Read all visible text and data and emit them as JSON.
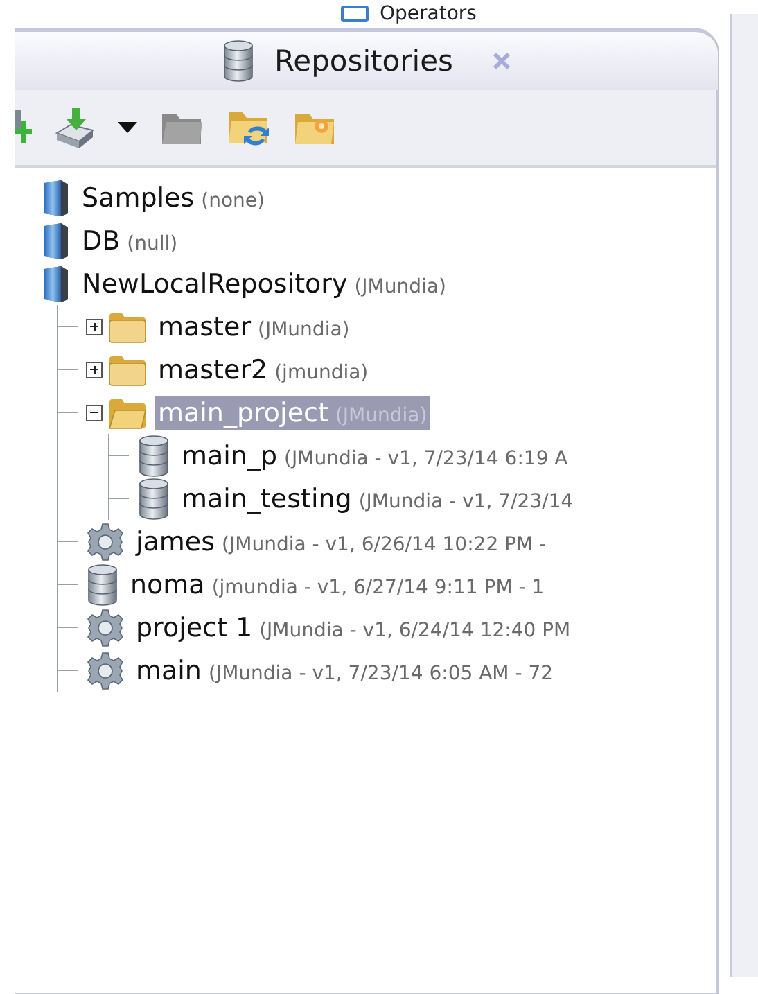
{
  "back_tab": {
    "label": "Operators"
  },
  "tab": {
    "label": "Repositories"
  },
  "toolbar": [
    {
      "kind": "add",
      "disabled": false
    },
    {
      "kind": "import",
      "disabled": false
    },
    {
      "kind": "caret",
      "disabled": false
    },
    {
      "kind": "folder",
      "disabled": true
    },
    {
      "kind": "refresh",
      "disabled": false
    },
    {
      "kind": "new-folder",
      "disabled": false
    }
  ],
  "tree": [
    {
      "kind": "repository",
      "name": "Samples",
      "detail": "(none)",
      "selected": false
    },
    {
      "kind": "repository",
      "name": "DB",
      "detail": "(null)",
      "selected": false
    },
    {
      "kind": "repository",
      "name": "NewLocalRepository",
      "detail": "(JMundia)",
      "selected": false,
      "children": [
        {
          "kind": "folder",
          "name": "master",
          "detail": "(JMundia)",
          "selected": false,
          "expanded": false
        },
        {
          "kind": "folder",
          "name": "master2",
          "detail": "(jmundia)",
          "selected": false,
          "expanded": false
        },
        {
          "kind": "folder",
          "name": "main_project",
          "detail": "(JMundia)",
          "selected": true,
          "expanded": true,
          "children": [
            {
              "kind": "data",
              "name": "main_p",
              "detail": "(JMundia - v1, 7/23/14 6:19 A",
              "selected": false
            },
            {
              "kind": "data",
              "name": "main_testing",
              "detail": "(JMundia - v1, 7/23/14",
              "selected": false
            }
          ]
        },
        {
          "kind": "process",
          "name": "james",
          "detail": "(JMundia - v1, 6/26/14 10:22 PM -",
          "selected": false
        },
        {
          "kind": "data",
          "name": "noma",
          "detail": "(jmundia - v1, 6/27/14 9:11 PM - 1",
          "selected": false
        },
        {
          "kind": "process",
          "name": "project 1",
          "detail": "(JMundia - v1, 6/24/14 12:40 PM",
          "selected": false
        },
        {
          "kind": "process",
          "name": "main",
          "detail": "(JMundia - v1, 7/23/14 6:05 AM - 72",
          "selected": false
        }
      ]
    }
  ]
}
